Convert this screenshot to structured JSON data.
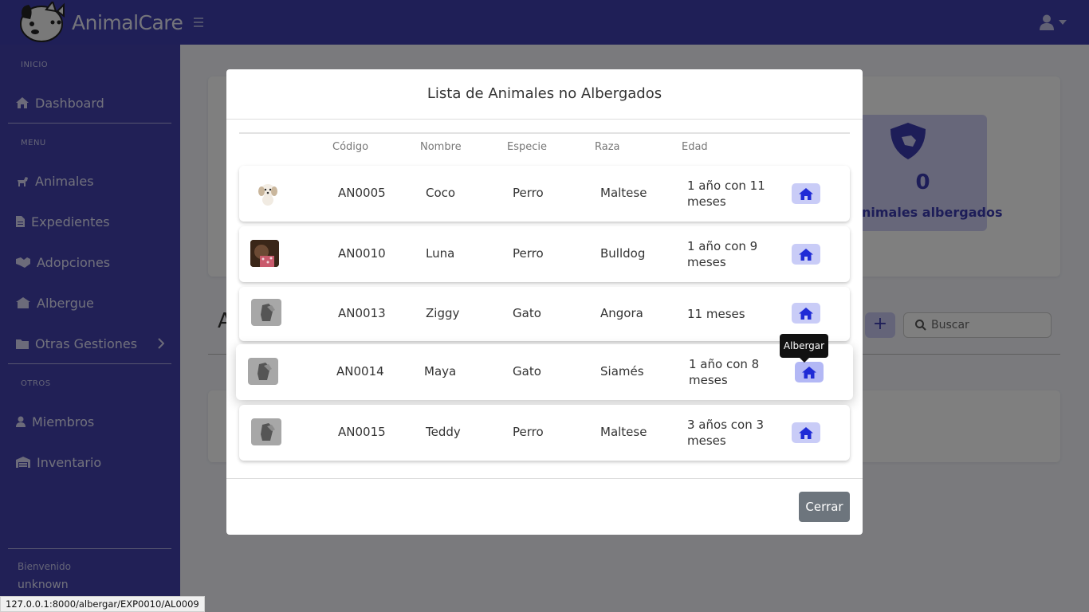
{
  "app": {
    "brand": "AnimalCare"
  },
  "sidebar": {
    "sections": [
      "INICIO",
      "MENU",
      "OTROS"
    ],
    "items": [
      {
        "label": "Dashboard",
        "icon": "home-icon"
      },
      {
        "label": "Animales",
        "icon": "dog-icon"
      },
      {
        "label": "Expedientes",
        "icon": "file-icon"
      },
      {
        "label": "Adopciones",
        "icon": "handshake-icon"
      },
      {
        "label": "Albergue",
        "icon": "shelter-icon"
      },
      {
        "label": "Otras Gestiones",
        "icon": "folder-icon"
      },
      {
        "label": "Miembros",
        "icon": "user-icon"
      },
      {
        "label": "Inventario",
        "icon": "warehouse-icon"
      }
    ],
    "footer": {
      "welcome": "Bienvenido",
      "user": "unknown"
    }
  },
  "background": {
    "stat_number": "0",
    "stat_label": "nimales albergados",
    "section_title_fragment": "A",
    "add_label": "+",
    "search_placeholder": "Buscar"
  },
  "modal": {
    "title": "Lista de Animales no Albergados",
    "headers": [
      "Código",
      "Nombre",
      "Especie",
      "Raza",
      "Edad"
    ],
    "rows": [
      {
        "codigo": "AN0005",
        "nombre": "Coco",
        "especie": "Perro",
        "raza": "Maltese",
        "edad_1": "1 año con 11",
        "edad_2": "meses",
        "image": "puppy-photo"
      },
      {
        "codigo": "AN0010",
        "nombre": "Luna",
        "especie": "Perro",
        "raza": "Bulldog",
        "edad_1": "1 año con 9",
        "edad_2": "meses",
        "image": "dog-photo"
      },
      {
        "codigo": "AN0013",
        "nombre": "Ziggy",
        "especie": "Gato",
        "raza": "Angora",
        "edad_1": "11 meses",
        "edad_2": "",
        "image": "placeholder-pet-icon"
      },
      {
        "codigo": "AN0014",
        "nombre": "Maya",
        "especie": "Gato",
        "raza": "Siamés",
        "edad_1": "1 año con 8",
        "edad_2": "meses",
        "image": "placeholder-pet-icon"
      },
      {
        "codigo": "AN0015",
        "nombre": "Teddy",
        "especie": "Perro",
        "raza": "Maltese",
        "edad_1": "3 años con 3",
        "edad_2": "meses",
        "image": "placeholder-pet-icon"
      }
    ],
    "tooltip": "Albergar",
    "close_label": "Cerrar"
  },
  "status_url": "127.0.0.1:8000/albergar/EXP0010/AL0009",
  "colors": {
    "topbar": "#3f3fae",
    "sidebar": "#4341ac",
    "accent_button": "#c9ccf7",
    "house_icon": "#1f2bd6",
    "close_button": "#6d757d"
  }
}
